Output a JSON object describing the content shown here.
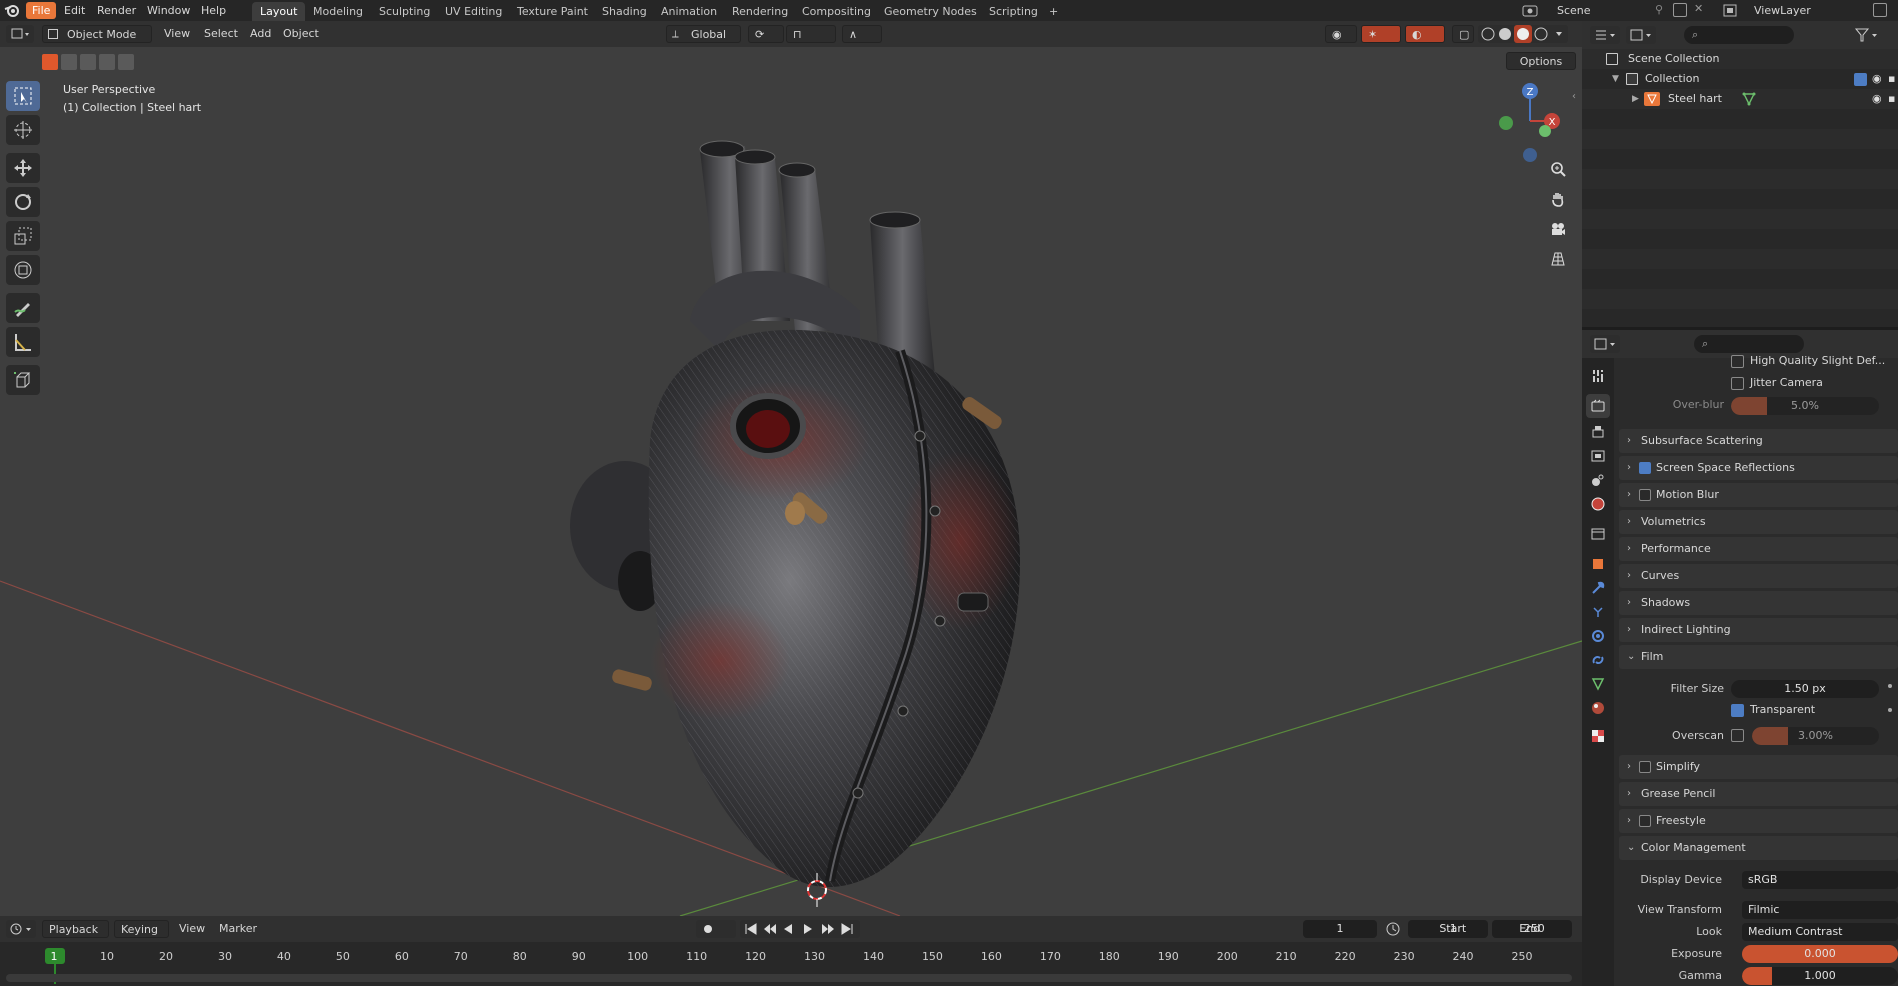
{
  "topbar": {
    "menus": [
      "File",
      "Edit",
      "Render",
      "Window",
      "Help"
    ],
    "workspaces": [
      "Layout",
      "Modeling",
      "Sculpting",
      "UV Editing",
      "Texture Paint",
      "Shading",
      "Animation",
      "Rendering",
      "Compositing",
      "Geometry Nodes",
      "Scripting"
    ],
    "add_tab": "+",
    "scene": "Scene",
    "view_layer": "ViewLayer"
  },
  "viewport": {
    "mode": "Object Mode",
    "menus": [
      "View",
      "Select",
      "Add",
      "Object"
    ],
    "transform_orientation": "Global",
    "options": "Options",
    "perspective": "User Perspective",
    "collection_info": "(1) Collection | Steel hart",
    "gizmo": {
      "z": "Z",
      "x": "X"
    }
  },
  "outliner": {
    "root": "Scene Collection",
    "collection": "Collection",
    "object": "Steel hart"
  },
  "properties": {
    "hq_slight_defocus": "High Quality Slight Def...",
    "jitter_camera": "Jitter Camera",
    "overblur_label": "Over-blur",
    "overblur_value": "5.0%",
    "panels": {
      "subsurface": "Subsurface Scattering",
      "ssr": "Screen Space Reflections",
      "motion_blur": "Motion Blur",
      "volumetrics": "Volumetrics",
      "performance": "Performance",
      "curves": "Curves",
      "shadows": "Shadows",
      "indirect": "Indirect Lighting",
      "film": "Film",
      "simplify": "Simplify",
      "grease_pencil": "Grease Pencil",
      "freestyle": "Freestyle",
      "color_management": "Color Management"
    },
    "film": {
      "filter_size_label": "Filter Size",
      "filter_size_value": "1.50 px",
      "transparent_label": "Transparent",
      "overscan_label": "Overscan",
      "overscan_value": "3.00%"
    },
    "color_management": {
      "display_device_label": "Display Device",
      "display_device_value": "sRGB",
      "view_transform_label": "View Transform",
      "view_transform_value": "Filmic",
      "look_label": "Look",
      "look_value": "Medium Contrast",
      "exposure_label": "Exposure",
      "exposure_value": "0.000",
      "gamma_label": "Gamma",
      "gamma_value": "1.000"
    }
  },
  "timeline": {
    "playback": "Playback",
    "keying": "Keying",
    "view": "View",
    "marker": "Marker",
    "current_frame": "1",
    "start_label": "Start",
    "start_value": "1",
    "end_label": "End",
    "end_value": "250",
    "frames": [
      "1",
      "10",
      "20",
      "30",
      "40",
      "50",
      "60",
      "70",
      "80",
      "90",
      "100",
      "110",
      "120",
      "130",
      "140",
      "150",
      "160",
      "170",
      "180",
      "190",
      "200",
      "210",
      "220",
      "230",
      "240",
      "250"
    ]
  },
  "colors": {
    "accent": "#e9773a",
    "active_tool": "#4f6a96",
    "checkbox_on": "#4d7dc4",
    "slider_fill": "#b55636"
  }
}
